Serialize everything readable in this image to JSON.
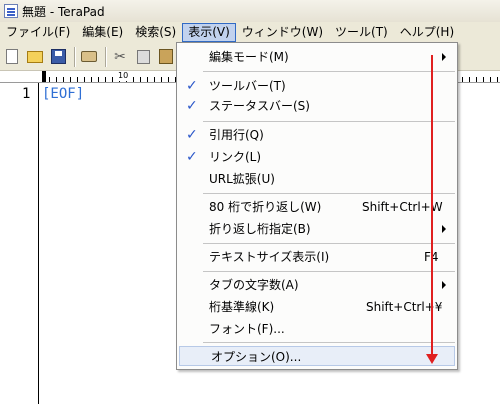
{
  "window": {
    "title": "無題 - TeraPad"
  },
  "menubar": {
    "items": [
      {
        "label": "ファイル(F)",
        "active": false
      },
      {
        "label": "編集(E)",
        "active": false
      },
      {
        "label": "検索(S)",
        "active": false
      },
      {
        "label": "表示(V)",
        "active": true
      },
      {
        "label": "ウィンドウ(W)",
        "active": false
      },
      {
        "label": "ツール(T)",
        "active": false
      },
      {
        "label": "ヘルプ(H)",
        "active": false
      }
    ]
  },
  "toolbar": {
    "buttons": [
      "new-file-icon",
      "open-folder-icon",
      "save-icon",
      "print-icon",
      "cut-icon",
      "copy-icon",
      "paste-icon"
    ]
  },
  "ruler": {
    "mark_0": "0",
    "mark_10": "10"
  },
  "editor": {
    "line_number": "1",
    "eof_marker": "[EOF]"
  },
  "dropdown": {
    "items": [
      {
        "label": "編集モード(M)",
        "shortcut": "",
        "checked": false,
        "submenu": true
      },
      {
        "label": "ツールバー(T)",
        "shortcut": "",
        "checked": true,
        "submenu": false
      },
      {
        "label": "ステータスバー(S)",
        "shortcut": "",
        "checked": true,
        "submenu": false
      },
      {
        "label": "引用行(Q)",
        "shortcut": "",
        "checked": true,
        "submenu": false
      },
      {
        "label": "リンク(L)",
        "shortcut": "",
        "checked": true,
        "submenu": false
      },
      {
        "label": "URL拡張(U)",
        "shortcut": "",
        "checked": false,
        "submenu": false
      },
      {
        "label": "80 桁で折り返し(W)",
        "shortcut": "Shift+Ctrl+W",
        "checked": false,
        "submenu": false
      },
      {
        "label": "折り返し桁指定(B)",
        "shortcut": "",
        "checked": false,
        "submenu": true
      },
      {
        "label": "テキストサイズ表示(I)",
        "shortcut": "F4",
        "checked": false,
        "submenu": false
      },
      {
        "label": "タブの文字数(A)",
        "shortcut": "",
        "checked": false,
        "submenu": true
      },
      {
        "label": "桁基準線(K)",
        "shortcut": "Shift+Ctrl+¥",
        "checked": false,
        "submenu": false
      },
      {
        "label": "フォント(F)...",
        "shortcut": "",
        "checked": false,
        "submenu": false
      },
      {
        "label": "オプション(O)...",
        "shortcut": "",
        "checked": false,
        "submenu": false
      }
    ],
    "check_glyph": "✓"
  },
  "colors": {
    "annotation_arrow": "#e02020",
    "menu_highlight": "#c1d2ee",
    "check": "#2b57c9"
  }
}
